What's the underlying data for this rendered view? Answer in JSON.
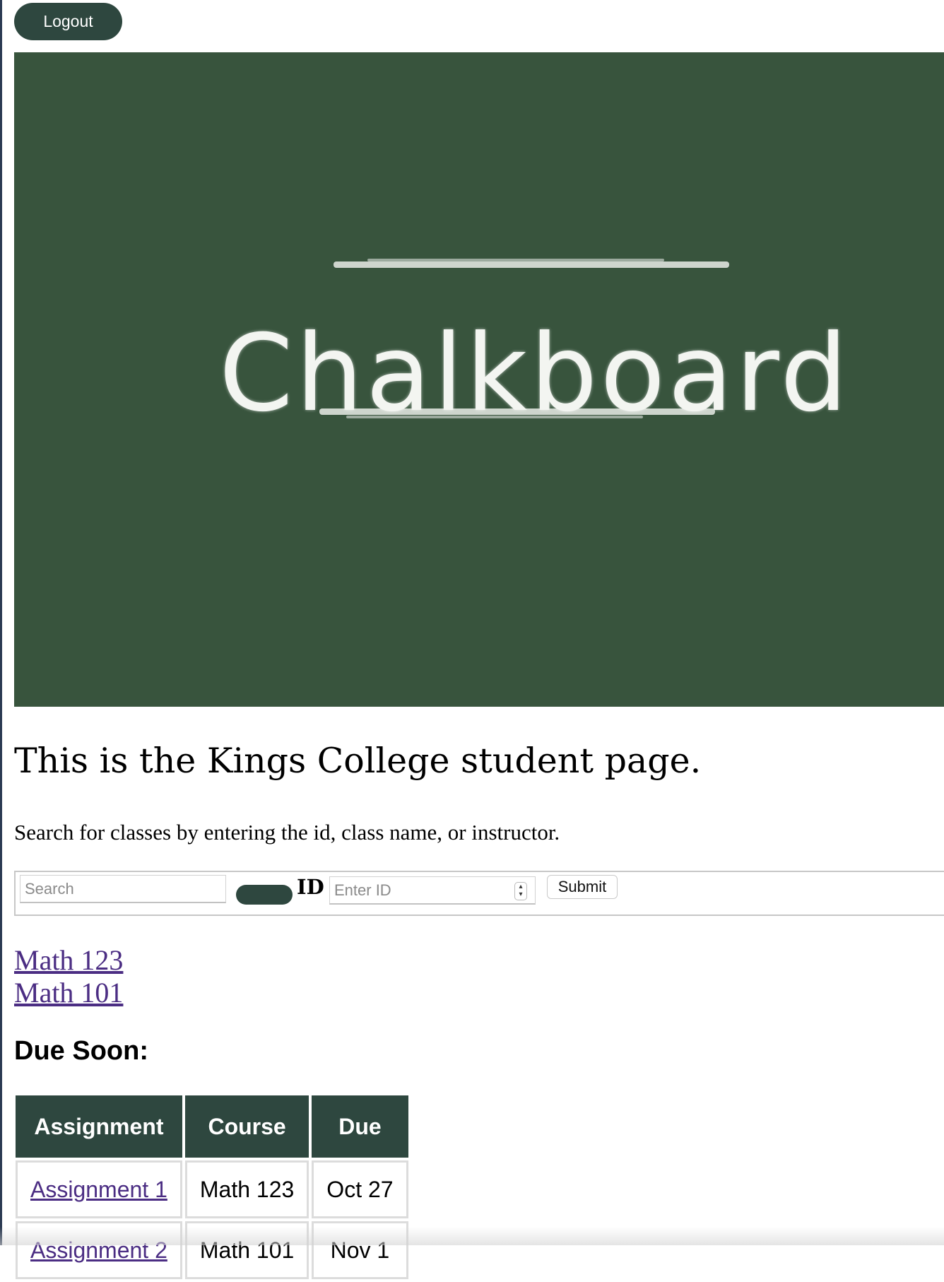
{
  "header": {
    "logout_label": "Logout"
  },
  "banner": {
    "logo_text": "Chalkboard"
  },
  "page": {
    "title": "This is the Kings College student page.",
    "instructions": "Search for classes by entering the id, class name, or instructor."
  },
  "search": {
    "placeholder": "Search",
    "id_label": "ID",
    "id_placeholder": "Enter ID",
    "submit_label": "Submit"
  },
  "classes": [
    "Math 123",
    "Math 101"
  ],
  "due_soon": {
    "heading": "Due Soon:",
    "columns": [
      "Assignment",
      "Course",
      "Due"
    ],
    "rows": [
      {
        "assignment": "Assignment 1",
        "course": "Math 123",
        "due": "Oct 27"
      },
      {
        "assignment": "Assignment 2",
        "course": "Math 101",
        "due": "Nov 1"
      }
    ]
  },
  "colors": {
    "banner": "#38543d",
    "button": "#2e473f",
    "link": "#4b2d83"
  }
}
